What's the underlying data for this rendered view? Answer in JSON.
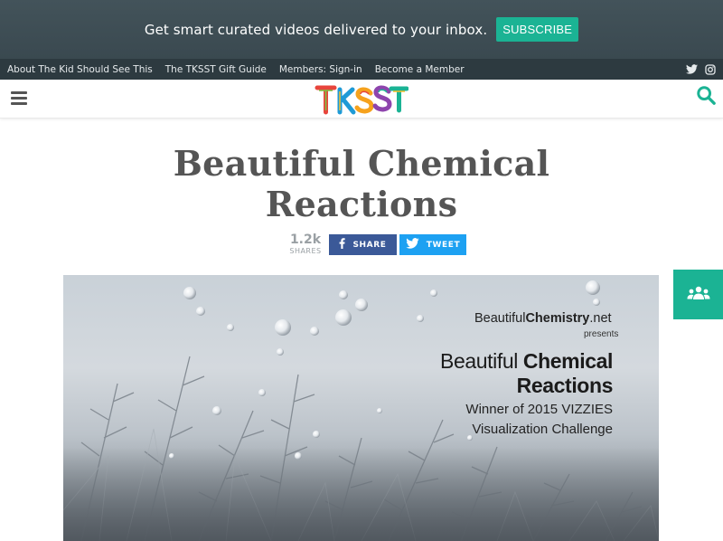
{
  "promo": {
    "text": "Get smart curated videos delivered to your inbox.",
    "button_label": "SUBSCRIBE"
  },
  "subnav": {
    "items": [
      {
        "label": "About The Kid Should See This"
      },
      {
        "label": "The TKSST Gift Guide"
      },
      {
        "label": "Members: Sign-in"
      },
      {
        "label": "Become a Member"
      }
    ],
    "social_icons": [
      "twitter-icon",
      "instagram-icon"
    ]
  },
  "header": {
    "logo_text": "TKSST",
    "icons": [
      "menu-icon",
      "search-icon"
    ]
  },
  "article": {
    "title": "Beautiful Chemical Reactions",
    "shares_count": "1.2k",
    "shares_label": "SHARES",
    "share_label": "SHARE",
    "tweet_label": "TWEET"
  },
  "video": {
    "brand_prefix": "Beautiful",
    "brand_bold": "Chemistry",
    "brand_suffix": ".net",
    "presents": "presents",
    "title_light": "Beautiful ",
    "title_bold": "Chemical Reactions",
    "winner_line1": "Winner of 2015 VIZZIES",
    "winner_line2": "Visualization Challenge"
  },
  "colors": {
    "accent": "#1bb394",
    "banner": "#3f4e55",
    "subnav": "#2d3a40",
    "facebook": "#3b5998",
    "twitter": "#1da1f2"
  }
}
